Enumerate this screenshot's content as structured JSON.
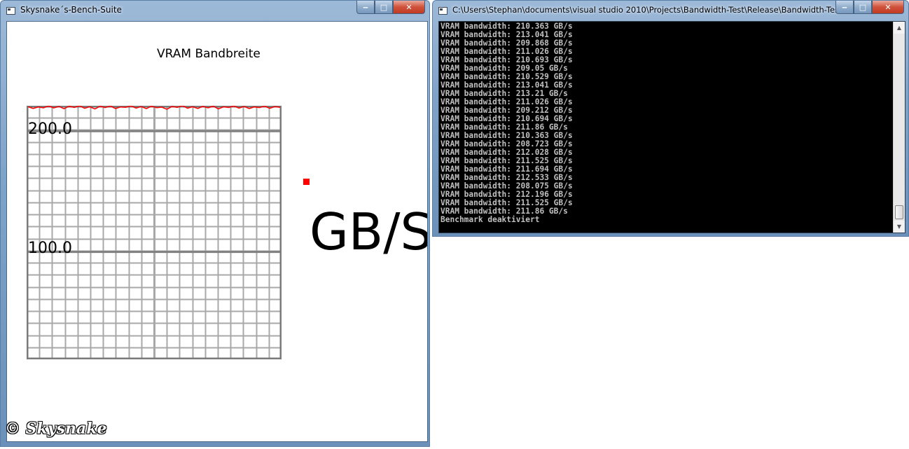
{
  "bench_window": {
    "title": "Skysnake´s-Bench-Suite",
    "chart_title": "VRAM Bandbreite",
    "unit_label": "GB/S",
    "watermark": "© Skysnake",
    "ticks": [
      "200.0",
      "100.0"
    ]
  },
  "console_window": {
    "title": "C:\\Users\\Stephan\\documents\\visual studio 2010\\Projects\\Bandwidth-Test\\Release\\Bandwidth-Test...",
    "lines": [
      "VRAM bandwidth: 210.363 GB/s",
      "VRAM bandwidth: 213.041 GB/s",
      "VRAM bandwidth: 209.868 GB/s",
      "VRAM bandwidth: 211.026 GB/s",
      "VRAM bandwidth: 210.693 GB/s",
      "VRAM bandwidth: 209.05 GB/s",
      "VRAM bandwidth: 210.529 GB/s",
      "VRAM bandwidth: 213.041 GB/s",
      "VRAM bandwidth: 213.21 GB/s",
      "VRAM bandwidth: 211.026 GB/s",
      "VRAM bandwidth: 209.212 GB/s",
      "VRAM bandwidth: 210.694 GB/s",
      "VRAM bandwidth: 211.86 GB/s",
      "VRAM bandwidth: 210.363 GB/s",
      "VRAM bandwidth: 208.723 GB/s",
      "VRAM bandwidth: 212.028 GB/s",
      "VRAM bandwidth: 211.525 GB/s",
      "VRAM bandwidth: 211.694 GB/s",
      "VRAM bandwidth: 212.533 GB/s",
      "VRAM bandwidth: 208.075 GB/s",
      "VRAM bandwidth: 212.196 GB/s",
      "VRAM bandwidth: 211.525 GB/s",
      "VRAM bandwidth: 211.86 GB/s",
      "Benchmark deaktiviert"
    ]
  },
  "chart_data": {
    "type": "line",
    "title": "VRAM Bandbreite",
    "xlabel": "",
    "ylabel": "GB/S",
    "ylim": [
      0,
      210
    ],
    "grid": true,
    "series": [
      {
        "color": "#ff0000",
        "values": [
          210.4,
          208.9,
          210.1,
          209.4,
          211.0,
          209.3,
          210.6,
          208.6,
          210.9,
          209.7,
          211.2,
          209.0,
          210.4,
          208.4,
          210.8,
          209.6,
          211.0,
          208.8,
          210.2,
          209.9,
          211.1,
          209.2,
          210.5,
          208.7,
          210.9,
          209.5,
          210.0,
          208.2,
          210.6,
          209.8,
          211.3,
          209.1,
          210.4,
          208.9,
          210.7,
          209.4,
          210.9,
          208.5,
          210.3,
          209.7,
          211.0,
          209.2,
          210.6,
          208.8,
          210.2,
          209.6,
          210.8,
          209.0,
          210.5,
          209.9
        ]
      }
    ]
  },
  "colors": {
    "series": "#ff0000",
    "console_bg": "#000000",
    "console_fg": "#c0c0c0"
  }
}
